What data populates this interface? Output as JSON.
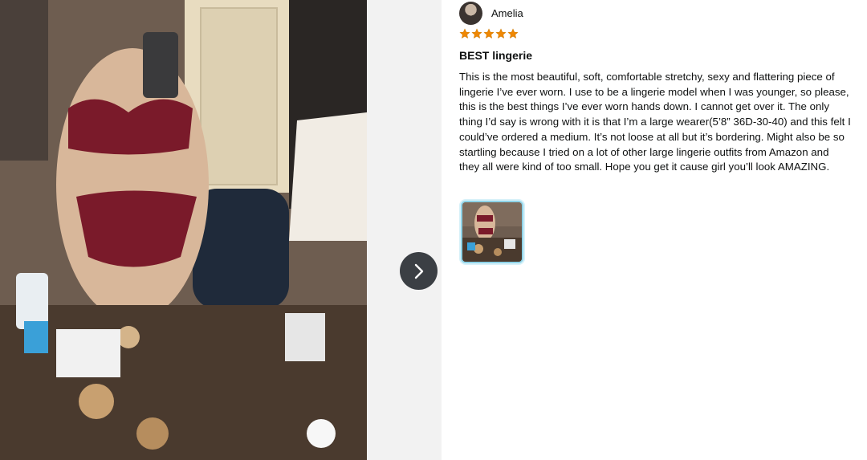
{
  "reviewer": {
    "name": "Amelia"
  },
  "rating": {
    "stars": 5,
    "max": 5,
    "star_color": "#f08804"
  },
  "review": {
    "title": "BEST lingerie",
    "body": "This is the most beautiful, soft, comfortable stretchy, sexy and flattering piece of lingerie I’ve ever worn. I use to be a lingerie model when I was younger, so please, this is the best things I’ve ever worn hands down. I cannot get over it. The only thing I’d say is wrong with it is that I’m a large wearer(5’8” 36D-30-40) and this felt I could’ve ordered a medium. It’s not loose at all but it’s bordering. Might also be so startling because I tried on a lot of other large lingerie outfits from Amazon and they all were kind of too small. Hope you get it cause girl you’ll look AMAZING."
  },
  "navigation": {
    "next_icon": "chevron-right-icon"
  },
  "colors": {
    "next_button_bg": "#3b3f44",
    "thumbnail_border": "#8fd3e8",
    "gutter_bg": "#f2f2f2"
  }
}
